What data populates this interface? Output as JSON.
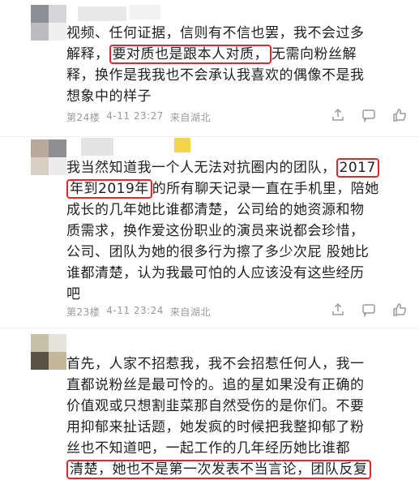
{
  "posts": [
    {
      "lines": [
        "视频、任何证据，信则有不信也罢，我不会过多",
        [
          "解释，",
          "要对质也是跟本人对质，",
          "无需向粉丝解"
        ],
        "释，换作是我我也不会承认我喜欢的偶像不是我",
        "想象中的样子"
      ],
      "floor": "第24楼",
      "time": "4-11 23:27",
      "location": "来自湖北"
    },
    {
      "lines": [
        [
          "我当然知道我一个人无法对抗圈内的团队，",
          "2017",
          ""
        ],
        [
          "",
          "年到2019年",
          "的所有聊天记录一直在手机里，陪她"
        ],
        "成长的几年她比谁都清楚，公司给的她资源和物",
        "质需求，换作爱这份职业的演员来说都会珍惜，",
        "公司、团队为她的很多行为擦了多少次屁 股她比",
        "谁都清楚，认为我最可怕的人应该没有这些经历",
        "吧"
      ],
      "floor": "第23楼",
      "time": "4-11 23:24",
      "location": "来自湖北"
    },
    {
      "lines": [
        "首先，人家不招惹我，我不会招惹任何人，我一",
        "直都说粉丝是最可怜的。追的星如果没有正确的",
        "价值观或只想割韭菜那自然受伤的是你们。不要",
        "用抑郁来扯话题，她发疯的时候把我整抑郁了粉",
        "丝也不知道吧，一起工作的几年经历她比谁都",
        "清楚，她也不是第一次发表不当言论，团队反复"
      ]
    }
  ],
  "colors": {
    "highlight": "#e0282e",
    "meta": "#9a9a9a"
  },
  "icons": [
    "share-icon",
    "comment-icon",
    "like-icon"
  ]
}
